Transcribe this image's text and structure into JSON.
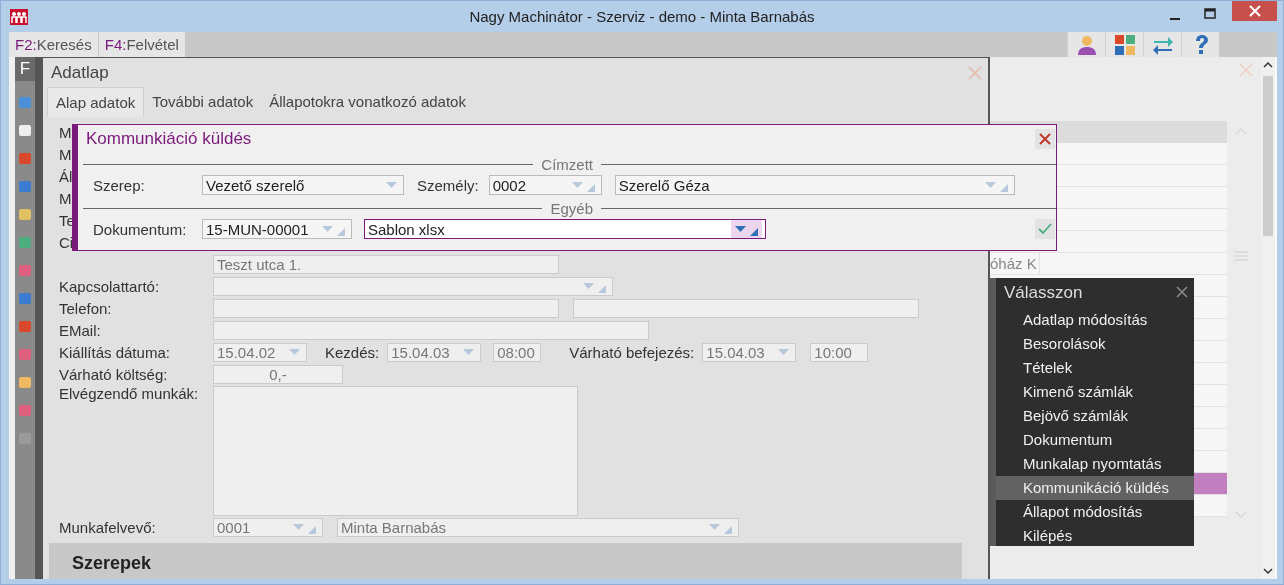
{
  "window": {
    "title": "Nagy Machinátor - Szerviz - demo - Minta Barnabás"
  },
  "toolbar": {
    "buttons": [
      {
        "key": "F2:",
        "label": "Keresés"
      },
      {
        "key": "F4:",
        "label": "Felvétel"
      }
    ]
  },
  "side_strip": {
    "letter": "F"
  },
  "adatlap": {
    "title": "Adatlap",
    "tabs": [
      {
        "label": "Alap adatok",
        "selected": true
      },
      {
        "label": "További adatok",
        "selected": false
      },
      {
        "label": "Állapotokra vonatkozó adatok",
        "selected": false
      }
    ]
  },
  "form": {
    "cut_labels": [
      "M",
      "M",
      "Ál",
      "M",
      "Te",
      "Ci"
    ],
    "address": {
      "value": "Teszt utca 1."
    },
    "contact": {
      "label": "Kapcsolattartó:"
    },
    "phone": {
      "label": "Telefon:"
    },
    "email": {
      "label": "EMail:"
    },
    "issue_date": {
      "label": "Kiállítás dátuma:",
      "value": "15.04.02"
    },
    "start": {
      "label": "Kezdés:",
      "date": "15.04.03",
      "time": "08:00"
    },
    "expected_end": {
      "label": "Várható befejezés:",
      "date": "15.04.03",
      "time": "10:00"
    },
    "expected_cost": {
      "label": "Várható költség:",
      "value": "0,-"
    },
    "work_to_do": {
      "label": "Elvégzendő munkák:"
    },
    "receiver": {
      "label": "Munkafelvevő:",
      "code": "0001",
      "name": "Minta Barnabás"
    }
  },
  "section": {
    "title": "Szerepek"
  },
  "right_panel": {
    "cell_text": "óház K"
  },
  "dialog": {
    "title": "Kommunkiáció küldés",
    "sections": [
      {
        "title": "Címzett"
      },
      {
        "title": "Egyéb"
      }
    ],
    "role": {
      "label": "Szerep:",
      "value": "Vezető szerelő"
    },
    "person": {
      "label": "Személy:",
      "code": "0002",
      "name": "Szerelő Géza"
    },
    "document": {
      "label": "Dokumentum:",
      "code": "15-MUN-00001",
      "template": "Sablon xlsx"
    }
  },
  "menu": {
    "title": "Válasszon",
    "items": [
      {
        "label": "Adatlap módosítás",
        "selected": false
      },
      {
        "label": "Besorolások",
        "selected": false
      },
      {
        "label": "Tételek",
        "selected": false
      },
      {
        "label": "Kimenő számlák",
        "selected": false
      },
      {
        "label": "Bejövő számlák",
        "selected": false
      },
      {
        "label": "Dokumentum",
        "selected": false
      },
      {
        "label": "Munkalap nyomtatás",
        "selected": false
      },
      {
        "label": "Kommunikáció küldés",
        "selected": true
      },
      {
        "label": "Állapot módosítás",
        "selected": false
      },
      {
        "label": "Kilépés",
        "selected": false
      }
    ]
  }
}
